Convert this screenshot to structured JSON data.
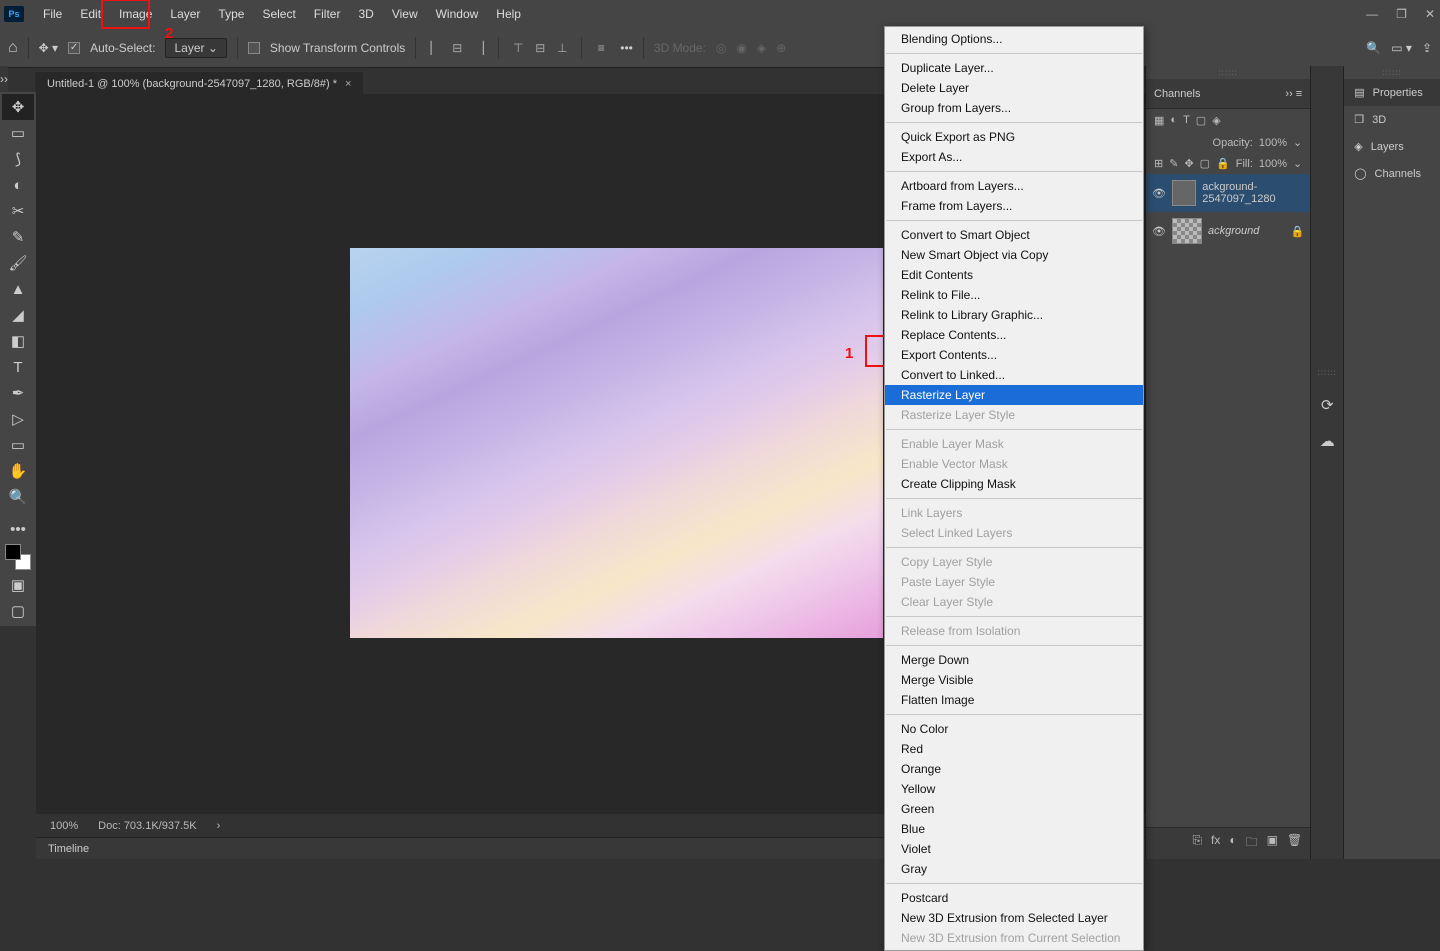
{
  "menu": [
    "File",
    "Edit",
    "Image",
    "Layer",
    "Type",
    "Select",
    "Filter",
    "3D",
    "View",
    "Window",
    "Help"
  ],
  "options": {
    "auto_select": "Auto-Select:",
    "target": "Layer",
    "show_transform": "Show Transform Controls",
    "mode3d": "3D Mode:"
  },
  "doc_tab": {
    "title": "Untitled-1 @ 100% (background-2547097_1280, RGB/8#) *"
  },
  "status": {
    "zoom": "100%",
    "doc": "Doc: 703.1K/937.5K"
  },
  "timeline": "Timeline",
  "panels": {
    "channels": "Channels",
    "properties": "Properties",
    "p3d": "3D",
    "layers": "Layers",
    "opacity_label": "Opacity:",
    "opacity_val": "100%",
    "fill_label": "Fill:",
    "fill_val": "100%",
    "lock_label": "Lock:"
  },
  "layers_list": [
    {
      "name": "ackground-2547097_1280",
      "sel": true,
      "locked": false
    },
    {
      "name": "ackground",
      "sel": false,
      "locked": true
    }
  ],
  "ctx": [
    {
      "t": "Blending Options...",
      "d": false
    },
    {
      "sep": true
    },
    {
      "t": "Duplicate Layer...",
      "d": false
    },
    {
      "t": "Delete Layer",
      "d": false
    },
    {
      "t": "Group from Layers...",
      "d": false
    },
    {
      "sep": true
    },
    {
      "t": "Quick Export as PNG",
      "d": false
    },
    {
      "t": "Export As...",
      "d": false
    },
    {
      "sep": true
    },
    {
      "t": "Artboard from Layers...",
      "d": false
    },
    {
      "t": "Frame from Layers...",
      "d": false
    },
    {
      "sep": true
    },
    {
      "t": "Convert to Smart Object",
      "d": false
    },
    {
      "t": "New Smart Object via Copy",
      "d": false
    },
    {
      "t": "Edit Contents",
      "d": false
    },
    {
      "t": "Relink to File...",
      "d": false
    },
    {
      "t": "Relink to Library Graphic...",
      "d": false
    },
    {
      "t": "Replace Contents...",
      "d": false
    },
    {
      "t": "Export Contents...",
      "d": false
    },
    {
      "t": "Convert to Linked...",
      "d": false
    },
    {
      "t": "Rasterize Layer",
      "d": false,
      "hl": true
    },
    {
      "t": "Rasterize Layer Style",
      "d": true
    },
    {
      "sep": true
    },
    {
      "t": "Enable Layer Mask",
      "d": true
    },
    {
      "t": "Enable Vector Mask",
      "d": true
    },
    {
      "t": "Create Clipping Mask",
      "d": false
    },
    {
      "sep": true
    },
    {
      "t": "Link Layers",
      "d": true
    },
    {
      "t": "Select Linked Layers",
      "d": true
    },
    {
      "sep": true
    },
    {
      "t": "Copy Layer Style",
      "d": true
    },
    {
      "t": "Paste Layer Style",
      "d": true
    },
    {
      "t": "Clear Layer Style",
      "d": true
    },
    {
      "sep": true
    },
    {
      "t": "Release from Isolation",
      "d": true
    },
    {
      "sep": true
    },
    {
      "t": "Merge Down",
      "d": false
    },
    {
      "t": "Merge Visible",
      "d": false
    },
    {
      "t": "Flatten Image",
      "d": false
    },
    {
      "sep": true
    },
    {
      "t": "No Color",
      "d": false
    },
    {
      "t": "Red",
      "d": false
    },
    {
      "t": "Orange",
      "d": false
    },
    {
      "t": "Yellow",
      "d": false
    },
    {
      "t": "Green",
      "d": false
    },
    {
      "t": "Blue",
      "d": false
    },
    {
      "t": "Violet",
      "d": false
    },
    {
      "t": "Gray",
      "d": false
    },
    {
      "sep": true
    },
    {
      "t": "Postcard",
      "d": false
    },
    {
      "t": "New 3D Extrusion from Selected Layer",
      "d": false
    },
    {
      "t": "New 3D Extrusion from Current Selection",
      "d": true
    }
  ],
  "annotations": {
    "label1": "1",
    "label2": "2"
  }
}
